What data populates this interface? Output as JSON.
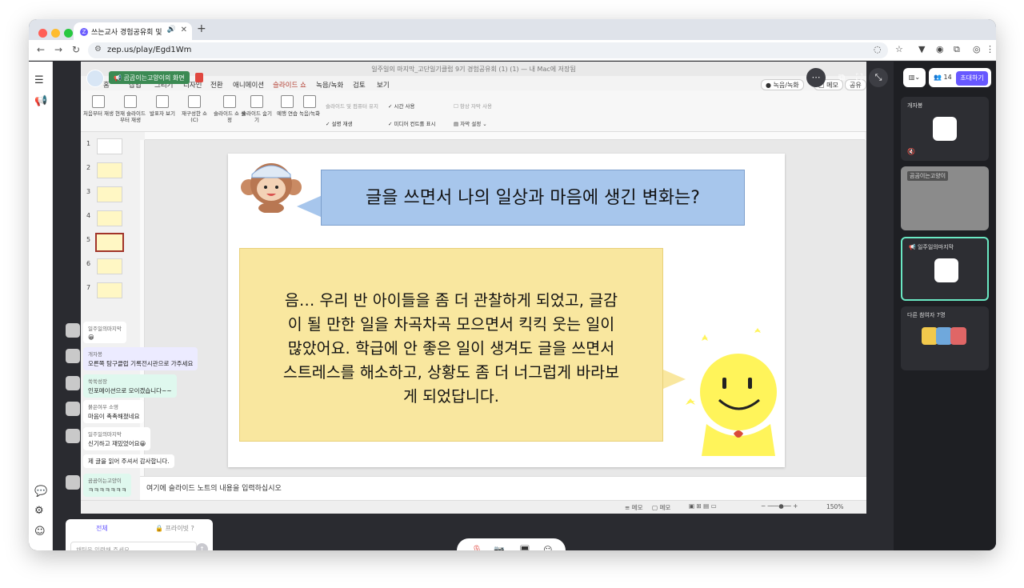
{
  "browser": {
    "tab_title": "쓰는교사 경험공유회 및 기록전",
    "new_tab": "+",
    "url": "zep.us/play/Egd1Wm"
  },
  "colors": {
    "accent": "#6758ff",
    "share_green": "#3b8a53",
    "mute_red": "#e0473f",
    "active_border": "#6ae8c3"
  },
  "icons": {
    "menu": "hamburger-icon",
    "announce": "megaphone-icon",
    "chat": "chat-icon",
    "settings": "gear-icon"
  },
  "share": {
    "label": "📢 곰곰이는고양이의 화면"
  },
  "ppt": {
    "title": "일주일의 마지막_고단일기클럽 9기 경험공유회 (1) (1) — 내 Mac에 저장됨",
    "tabs": [
      "홈",
      "삽입",
      "그리기",
      "디자인",
      "전환",
      "애니메이션",
      "슬라이드 쇼",
      "녹음/녹화",
      "검토",
      "보기"
    ],
    "active_tab": "슬라이드 쇼",
    "record_label": "녹음/녹화",
    "memo_label": "메모",
    "share_label": "공유",
    "ribbon": {
      "from_start": "처음부터 재생",
      "from_current": "현재 슬라이드부터 재생",
      "presenter": "발표자 보기",
      "custom": "재구성한 쇼(C)",
      "setup": "슬라이드 쇼 설정",
      "hide": "슬라이드 숨기기",
      "rehearse": "예행 연습",
      "record": "녹음/녹화",
      "opt_record_keep": "슬라이드 및 컴퓨터 유지",
      "opt_timing": "시간 사용",
      "opt_narration": "설명 재생",
      "opt_media": "미디어 컨트롤 표시",
      "opt_subtitle": "항상 자막 사용",
      "opt_subtitle_settings": "자막 설정"
    },
    "thumbs": [
      "1",
      "2",
      "3",
      "4",
      "5",
      "6",
      "7"
    ],
    "slide": {
      "question": "글을 쓰면서 나의 일상과 마음에 생긴 변화는?",
      "answer_lines": [
        "음… 우리 반 아이들을 좀 더 관찰하게 되었고, 글감",
        "이 될 만한 일을 차곡차곡 모으면서 킥킥 웃는 일이",
        "많았어요. 학급에 안 좋은 일이 생겨도 글을 쓰면서",
        "스트레스를 해소하고, 상황도 좀 더 너그럽게 바라보",
        "게 되었답니다."
      ]
    },
    "notes_placeholder": "여기에 슬라이드 노트의 내용을 입력하십시오",
    "status": {
      "memo": "메모",
      "memo2": "메모",
      "zoom": "150%"
    }
  },
  "chat": {
    "messages": [
      {
        "name": "일주일의마지막",
        "text": "😀"
      },
      {
        "name": "개자봉",
        "text": "오른쪽 탐구클럽 기록전시관으로 가주세요"
      },
      {
        "name": "쑥쑥성장",
        "text": "인포메이션으로 모이겠습니다~~"
      },
      {
        "name": "붉은여우 소영",
        "text": "마음이 촉촉해졌네요"
      },
      {
        "name": "일주일의마지막",
        "text": "신기하고 재밌었어요😀"
      },
      {
        "name": "",
        "text": "제 글을 읽어 주셔서 감사합니다."
      },
      {
        "name": "곰곰이는고양이",
        "text": "ㅋㅋㅋㅋㅋㅋㅋ"
      }
    ],
    "tab_all": "전체",
    "tab_private": "🔒 프라이빗 ?",
    "input_placeholder": "채팅을 입력해 주세요"
  },
  "right_panel": {
    "participant_count": "14",
    "invite": "초대하기",
    "cards": [
      {
        "name": "개자봉"
      },
      {
        "name": "곰곰이는고양이"
      },
      {
        "name": "📢 일주일의마지막"
      },
      {
        "name": "다른 참여자 7명"
      }
    ]
  }
}
